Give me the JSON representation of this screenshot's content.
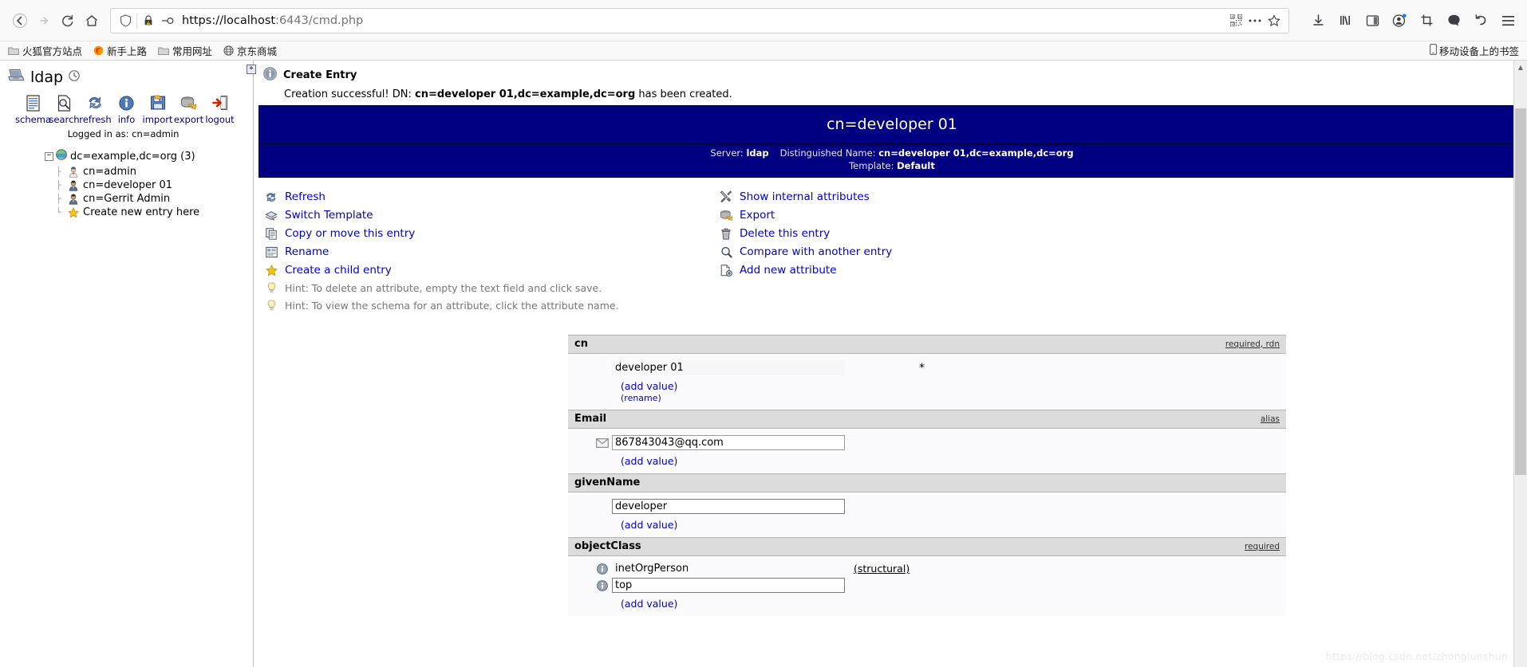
{
  "browser": {
    "nav": {
      "back": "back-arrow",
      "forward": "forward-arrow",
      "reload": "reload",
      "home": "home"
    },
    "url": {
      "scheme_host": "https://localhost",
      "rest": ":6443/cmd.php",
      "full": "https://localhost:6443/cmd.php",
      "shield_icon": "tracking-protection-shield",
      "lock_icon": "lock-warning",
      "permissions_icon": "permissions-plug"
    },
    "urlbar_actions": [
      "qr-code-icon",
      "page-actions-icon",
      "bookmark-star-icon"
    ],
    "toolbar_icons": [
      "downloads-icon",
      "library-icon",
      "sidebar-icon",
      "account-icon",
      "screenshot-icon",
      "pocket-icon",
      "undo-icon",
      "menu-icon"
    ],
    "bookmarks": [
      {
        "label": "火狐官方站点",
        "icon": "folder-icon"
      },
      {
        "label": "新手上路",
        "icon": "firefox-icon"
      },
      {
        "label": "常用网址",
        "icon": "folder-icon"
      },
      {
        "label": "京东商城",
        "icon": "globe-icon"
      }
    ],
    "bookmarks_right": {
      "label": "移动设备上的书签",
      "icon": "mobile-icon"
    }
  },
  "sidebar": {
    "server_name": "ldap",
    "clock_icon": "clock-icon",
    "computer_icon": "computer-icon",
    "tools": [
      {
        "label": "schema",
        "icon": "schema-icon"
      },
      {
        "label": "search",
        "icon": "search-icon"
      },
      {
        "label": "refresh",
        "icon": "refresh-icon"
      },
      {
        "label": "info",
        "icon": "info-icon"
      },
      {
        "label": "import",
        "icon": "import-icon"
      },
      {
        "label": "export",
        "icon": "export-icon"
      },
      {
        "label": "logout",
        "icon": "logout-icon"
      }
    ],
    "logged_in_as": "Logged in as: cn=admin",
    "tree": {
      "root": {
        "label": "dc=example,dc=org (3)",
        "expander": "−",
        "icon": "globe-icon"
      },
      "children": [
        {
          "label": "cn=admin",
          "icon": "user-admin-icon"
        },
        {
          "label": "cn=developer 01",
          "icon": "user-icon"
        },
        {
          "label": "cn=Gerrit Admin",
          "icon": "user-icon"
        },
        {
          "label": "Create new entry here",
          "icon": "star-icon"
        }
      ]
    },
    "splitter_button": "+"
  },
  "notice": {
    "icon": "info-icon",
    "title": "Create Entry",
    "prefix": "Creation successful! DN: ",
    "dn": "cn=developer 01,dc=example,dc=org",
    "suffix": " has been created."
  },
  "entry": {
    "title": "cn=developer 01",
    "server_label": "Server:",
    "server_value": "ldap",
    "dn_label": "Distinguished Name:",
    "dn_value": "cn=developer 01,dc=example,dc=org",
    "template_label": "Template:",
    "template_value": "Default",
    "banner_color": "#000080"
  },
  "actions": {
    "left": [
      {
        "label": "Refresh",
        "icon": "refresh-icon",
        "hint": false
      },
      {
        "label": "Switch Template",
        "icon": "template-icon",
        "hint": false
      },
      {
        "label": "Copy or move this entry",
        "icon": "copy-icon",
        "hint": false
      },
      {
        "label": "Rename",
        "icon": "rename-icon",
        "hint": false
      },
      {
        "label": "Create a child entry",
        "icon": "star-icon",
        "hint": false
      },
      {
        "label": "Hint: To delete an attribute, empty the text field and click save.",
        "icon": "lightbulb-icon",
        "hint": true
      },
      {
        "label": "Hint: To view the schema for an attribute, click the attribute name.",
        "icon": "lightbulb-icon",
        "hint": true
      }
    ],
    "right": [
      {
        "label": "Show internal attributes",
        "icon": "tools-icon"
      },
      {
        "label": "Export",
        "icon": "export-icon"
      },
      {
        "label": "Delete this entry",
        "icon": "trash-icon"
      },
      {
        "label": "Compare with another entry",
        "icon": "compare-icon"
      },
      {
        "label": "Add new attribute",
        "icon": "add-attribute-icon"
      }
    ]
  },
  "attributes": [
    {
      "name": "cn",
      "flags": "required, rdn",
      "values": [
        {
          "value": "developer 01",
          "readonly": true,
          "icon": null,
          "rdn_marker": "*",
          "tag": null
        }
      ],
      "links": [
        {
          "label": "(add value)",
          "small": false
        },
        {
          "label": "(rename)",
          "small": true
        }
      ]
    },
    {
      "name": "Email",
      "flags": "alias",
      "values": [
        {
          "value": "867843043@qq.com",
          "readonly": false,
          "icon": "envelope-icon",
          "rdn_marker": null,
          "tag": null
        }
      ],
      "links": [
        {
          "label": "(add value)",
          "small": false
        }
      ]
    },
    {
      "name": "givenName",
      "flags": "",
      "values": [
        {
          "value": "developer",
          "readonly": false,
          "icon": null,
          "rdn_marker": null,
          "tag": null,
          "focused": true
        }
      ],
      "links": [
        {
          "label": "(add value)",
          "small": false
        }
      ]
    },
    {
      "name": "objectClass",
      "flags": "required",
      "values": [
        {
          "value": "inetOrgPerson",
          "readonly": true,
          "static": true,
          "icon": "info-icon",
          "rdn_marker": null,
          "tag": "(structural)"
        },
        {
          "value": "top",
          "readonly": false,
          "icon": "info-icon",
          "rdn_marker": null,
          "tag": null
        }
      ],
      "links": [
        {
          "label": "(add value)",
          "small": false
        }
      ]
    }
  ],
  "watermark": "https://blog.csdn.net/zhonglunshun"
}
